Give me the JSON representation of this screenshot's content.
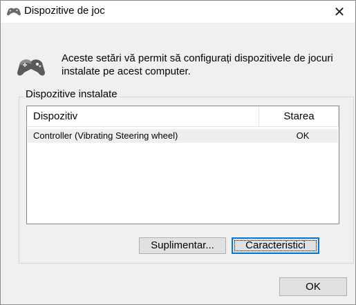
{
  "window": {
    "title": "Dispozitive de joc",
    "close_label": "✕",
    "app_icon": "gamepad-icon"
  },
  "intro": {
    "icon": "gamepad-icon",
    "text": "Aceste setări vă permit să configurați dispozitivele de jocuri instalate pe acest computer."
  },
  "installed_group": {
    "title": "Dispozitive instalate",
    "columns": [
      "Dispozitiv",
      "Starea"
    ],
    "rows": [
      {
        "name": "Controller (Vibrating Steering wheel)",
        "status": "OK"
      }
    ]
  },
  "buttons": {
    "advanced": "Suplimentar...",
    "properties": "Caracteristici",
    "ok": "OK"
  }
}
